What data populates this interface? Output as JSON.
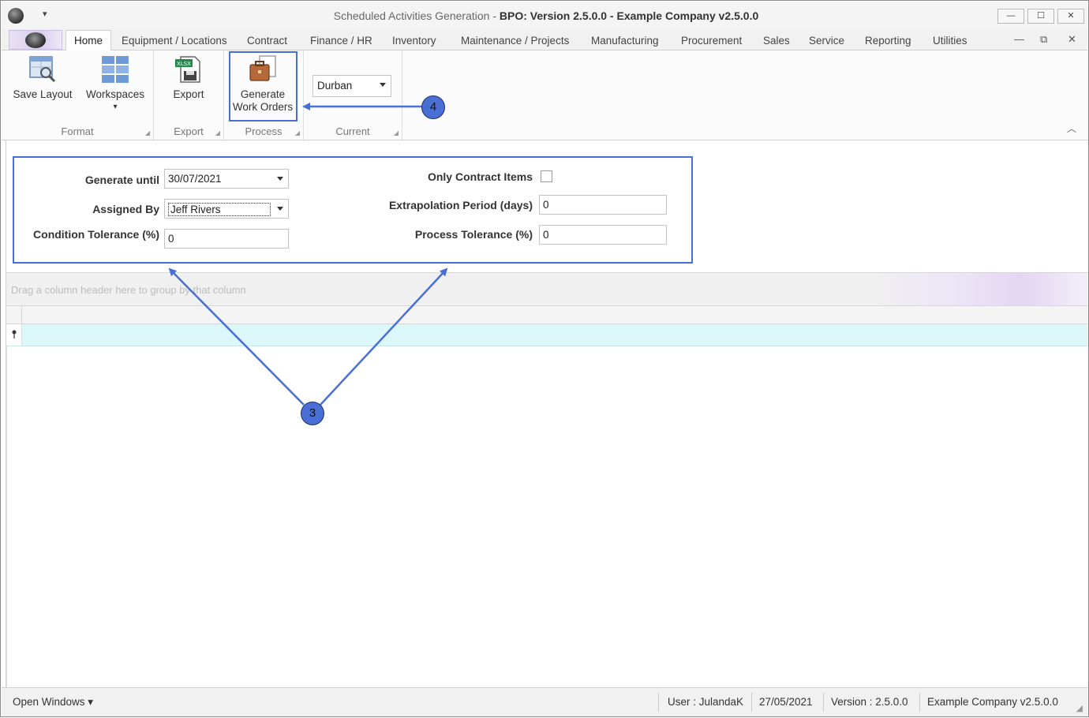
{
  "window": {
    "title_prefix": "Scheduled Activities Generation - ",
    "title_main": "BPO: Version 2.5.0.0 - Example Company v2.5.0.0",
    "min_label": "—",
    "max_label": "☐",
    "close_label": "✕"
  },
  "quick_access": {
    "arrow": "▾"
  },
  "tabs": [
    {
      "label": "Home"
    },
    {
      "label": "Equipment / Locations"
    },
    {
      "label": "Contract"
    },
    {
      "label": "Finance / HR"
    },
    {
      "label": "Inventory"
    },
    {
      "label": "Maintenance / Projects"
    },
    {
      "label": "Manufacturing"
    },
    {
      "label": "Procurement"
    },
    {
      "label": "Sales"
    },
    {
      "label": "Service"
    },
    {
      "label": "Reporting"
    },
    {
      "label": "Utilities"
    }
  ],
  "tab_controls": {
    "minimize": "—",
    "restore": "⧉",
    "close": "✕"
  },
  "ribbon": {
    "format": {
      "label": "Format",
      "save_layout": "Save Layout",
      "workspaces": "Workspaces",
      "workspaces_arrow": "▾"
    },
    "export": {
      "label": "Export",
      "export_btn": "Export",
      "xlsx_badge": "XLSX"
    },
    "process": {
      "label": "Process",
      "generate_line1": "Generate",
      "generate_line2": "Work Orders"
    },
    "current": {
      "label": "Current",
      "site_value": "Durban"
    },
    "launcher": "◢",
    "collapse": "︿"
  },
  "filters": {
    "generate_until": {
      "label": "Generate until",
      "value": "30/07/2021"
    },
    "assigned_by": {
      "label": "Assigned By",
      "value": "Jeff Rivers"
    },
    "condition_tolerance": {
      "label": "Condition Tolerance (%)",
      "value": "0"
    },
    "only_contract_items": {
      "label": "Only Contract Items",
      "checked": false
    },
    "extrapolation_period": {
      "label": "Extrapolation Period (days)",
      "value": "0"
    },
    "process_tolerance": {
      "label": "Process Tolerance (%)",
      "value": "0"
    }
  },
  "grid": {
    "group_hint": "Drag a column header here to group by that column",
    "filter_row_icon": "📍"
  },
  "status": {
    "open_windows": "Open Windows ▾",
    "user": "User : JulandaK",
    "date": "27/05/2021",
    "version": "Version : 2.5.0.0",
    "company": "Example Company v2.5.0.0"
  },
  "annotations": {
    "callout_3": "3",
    "callout_4": "4"
  },
  "colors": {
    "annotation_blue": "#4a6fd4",
    "filter_row": "#dcf7fa"
  }
}
